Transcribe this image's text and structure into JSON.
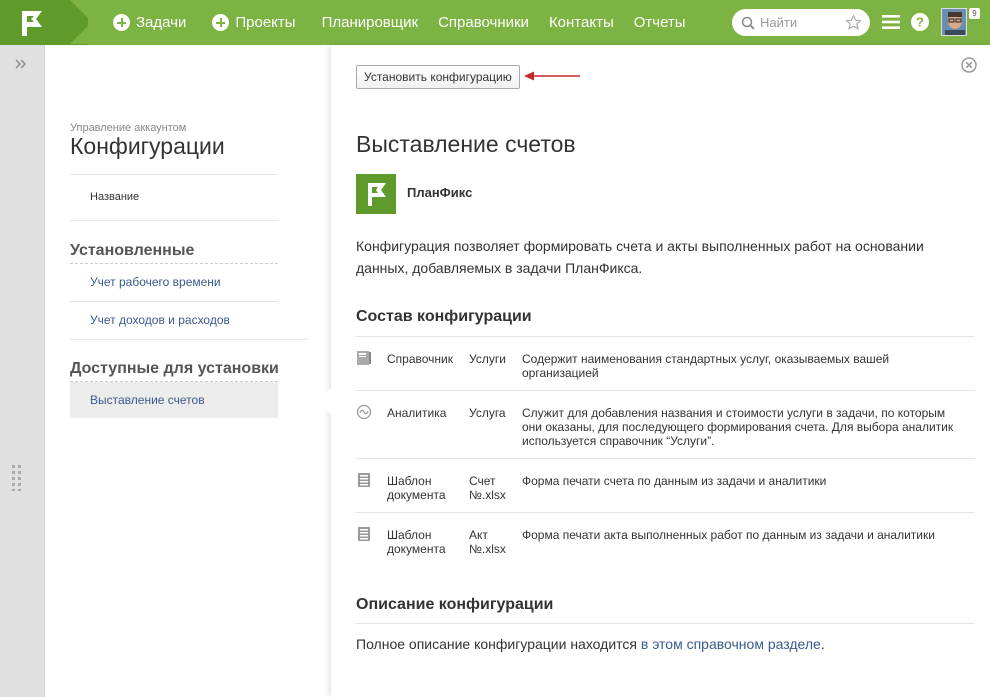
{
  "topbar": {
    "nav": [
      {
        "label": "Задачи",
        "plus": true
      },
      {
        "label": "Проекты",
        "plus": true
      },
      {
        "label": "Планировщик",
        "plus": false
      },
      {
        "label": "Справочники",
        "plus": false
      },
      {
        "label": "Контакты",
        "plus": false
      },
      {
        "label": "Отчеты",
        "plus": false
      }
    ],
    "search_placeholder": "Найти",
    "avatar_badge": "9",
    "brand_color": "#7cb342"
  },
  "left": {
    "account_label": "Управление аккаунтом",
    "title": "Конфигурации",
    "column_name": "Название",
    "installed_heading": "Установленные",
    "installed": [
      "Учет рабочего времени",
      "Учет доходов и расходов"
    ],
    "available_heading": "Доступные для установки",
    "available": [
      "Выставление счетов"
    ]
  },
  "main": {
    "install_button": "Установить конфигурацию",
    "title": "Выставление счетов",
    "brand": "ПланФикс",
    "description": "Конфигурация позволяет формировать счета и акты выполненных работ на основании данных, добавляемых в задачи ПланФикса.",
    "composition_heading": "Состав конфигурации",
    "composition": [
      {
        "icon": "book-icon",
        "type": "Справочник",
        "name": "Услуги",
        "desc": "Содержит наименования стандартных услуг, оказываемых вашей организацией"
      },
      {
        "icon": "analytics-icon",
        "type": "Аналитика",
        "name": "Услуга",
        "desc": "Служит для добавления названия и стоимости услуги в задачи, по которым они оказаны, для последующего формирования счета. Для выбора аналитик используется справочник “Услуги”."
      },
      {
        "icon": "document-template-icon",
        "type": "Шаблон документа",
        "name": "Счет №.xlsx",
        "desc": "Форма печати счета по данным из задачи и аналитики"
      },
      {
        "icon": "document-template-icon",
        "type": "Шаблон документа",
        "name": "Акт №.xlsx",
        "desc": "Форма печати акта выполненных работ по данным из задачи и аналитики"
      }
    ],
    "about_heading": "Описание конфигурации",
    "about_text": "Полное описание конфигурации находится ",
    "about_link": "в этом справочном разделе",
    "about_end": "."
  }
}
